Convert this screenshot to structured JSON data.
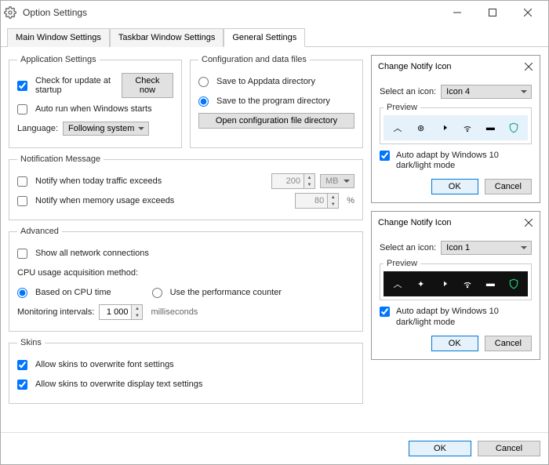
{
  "window": {
    "title": "Option Settings"
  },
  "tabs": {
    "main": "Main Window Settings",
    "taskbar": "Taskbar Window Settings",
    "general": "General Settings"
  },
  "appSettings": {
    "legend": "Application Settings",
    "checkUpdate": "Check for update at startup",
    "checkNow": "Check now",
    "autoRun": "Auto run when Windows starts",
    "languageLabel": "Language:",
    "languageValue": "Following system"
  },
  "configFiles": {
    "legend": "Configuration and data files",
    "saveAppdata": "Save to Appdata directory",
    "saveProgram": "Save to the program directory",
    "openDir": "Open configuration file directory"
  },
  "notif": {
    "legend": "Notification Message",
    "traffic": "Notify when today traffic exceeds",
    "trafficVal": "200",
    "trafficUnit": "MB",
    "memory": "Notify when memory usage exceeds",
    "memoryVal": "80",
    "memoryUnit": "%"
  },
  "advanced": {
    "legend": "Advanced",
    "showAll": "Show all network connections",
    "cpuMethod": "CPU usage acquisition method:",
    "cpuTime": "Based on CPU time",
    "perfCounter": "Use the performance counter",
    "monLabel": "Monitoring intervals:",
    "monVal": "1 000",
    "monUnit": "milliseconds"
  },
  "skins": {
    "legend": "Skins",
    "font": "Allow skins to overwrite font settings",
    "text": "Allow skins to overwrite display text settings"
  },
  "notify1": {
    "title": "Change Notify Icon",
    "selectLabel": "Select an icon:",
    "selectValue": "Icon 4",
    "previewLabel": "Preview",
    "autoAdapt": "Auto adapt by Windows 10 dark/light mode",
    "ok": "OK",
    "cancel": "Cancel"
  },
  "notify2": {
    "title": "Change Notify Icon",
    "selectLabel": "Select an icon:",
    "selectValue": "Icon 1",
    "previewLabel": "Preview",
    "autoAdapt": "Auto adapt by Windows 10 dark/light mode",
    "ok": "OK",
    "cancel": "Cancel"
  },
  "bottom": {
    "ok": "OK",
    "cancel": "Cancel"
  }
}
